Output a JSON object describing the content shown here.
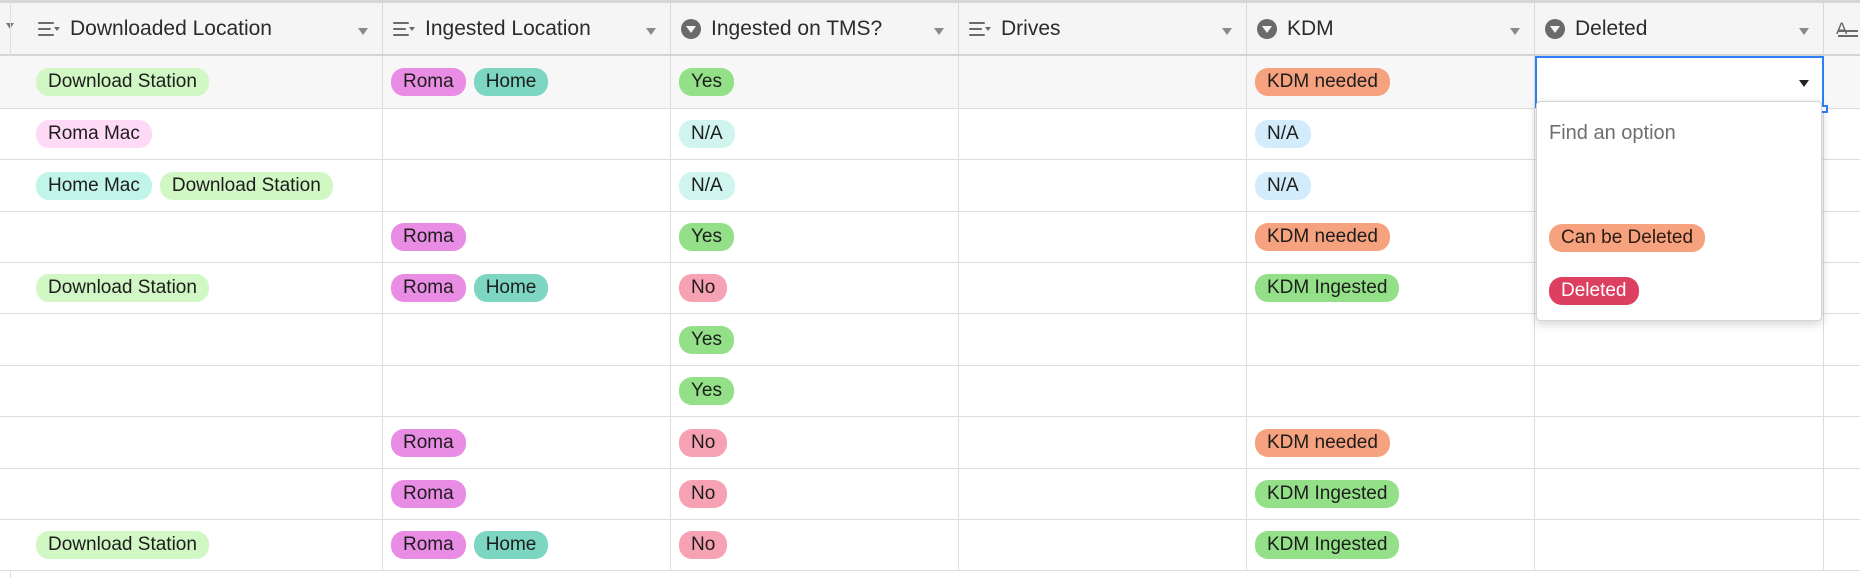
{
  "columns": [
    {
      "label": "Downloaded Location",
      "icon": "multi-select-icon"
    },
    {
      "label": "Ingested Location",
      "icon": "multi-select-icon"
    },
    {
      "label": "Ingested on TMS?",
      "icon": "single-select-icon"
    },
    {
      "label": "Drives",
      "icon": "multi-select-icon"
    },
    {
      "label": "KDM",
      "icon": "single-select-icon"
    },
    {
      "label": "Deleted",
      "icon": "single-select-icon"
    }
  ],
  "next_column_icon": "long-text-icon",
  "rows": [
    {
      "downloaded": [
        "Download Station"
      ],
      "ingested": [
        "Roma",
        "Home"
      ],
      "tms": "Yes",
      "drives": [],
      "kdm": "KDM needed",
      "deleted": ""
    },
    {
      "downloaded": [
        "Roma Mac"
      ],
      "ingested": [],
      "tms": "N/A",
      "drives": [],
      "kdm": "N/A",
      "deleted": ""
    },
    {
      "downloaded": [
        "Home Mac",
        "Download Station"
      ],
      "ingested": [],
      "tms": "N/A",
      "drives": [],
      "kdm": "N/A",
      "deleted": ""
    },
    {
      "downloaded": [],
      "ingested": [
        "Roma"
      ],
      "tms": "Yes",
      "drives": [],
      "kdm": "KDM needed",
      "deleted": ""
    },
    {
      "downloaded": [
        "Download Station"
      ],
      "ingested": [
        "Roma",
        "Home"
      ],
      "tms": "No",
      "drives": [],
      "kdm": "KDM Ingested",
      "deleted": ""
    },
    {
      "downloaded": [],
      "ingested": [],
      "tms": "Yes",
      "drives": [],
      "kdm": "",
      "deleted": ""
    },
    {
      "downloaded": [],
      "ingested": [],
      "tms": "Yes",
      "drives": [],
      "kdm": "",
      "deleted": ""
    },
    {
      "downloaded": [],
      "ingested": [
        "Roma"
      ],
      "tms": "No",
      "drives": [],
      "kdm": "KDM needed",
      "deleted": ""
    },
    {
      "downloaded": [],
      "ingested": [
        "Roma"
      ],
      "tms": "No",
      "drives": [],
      "kdm": "KDM Ingested",
      "deleted": ""
    },
    {
      "downloaded": [
        "Download Station"
      ],
      "ingested": [
        "Roma",
        "Home"
      ],
      "tms": "No",
      "drives": [],
      "kdm": "KDM Ingested",
      "deleted": ""
    }
  ],
  "dropdown": {
    "placeholder": "Find an option",
    "options": [
      "Can be Deleted",
      "Deleted"
    ]
  },
  "colors": {
    "selection_outline": "#2d7ff9",
    "Download Station": "#d1f7c4",
    "Roma Mac": "#ffdaf6",
    "Home Mac": "#c2f5e9",
    "Roma": "#e98ce4",
    "Home": "#7dd6c1",
    "Yes": "#93e088",
    "No": "#f7a2b3",
    "KDM needed": "#f6a27e",
    "KDM Ingested": "#93e088",
    "Can be Deleted": "#f6a27e",
    "Deleted": "#dd3f60"
  }
}
